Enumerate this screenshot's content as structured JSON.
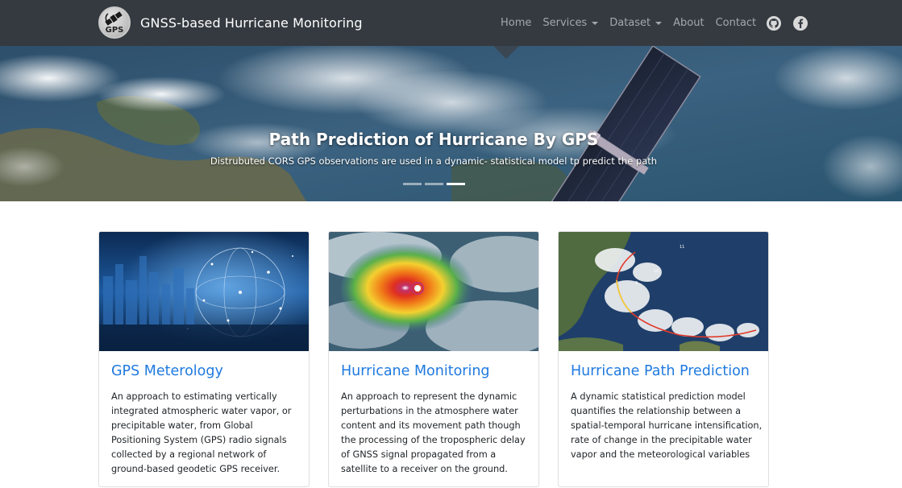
{
  "navbar": {
    "brand_title": "GNSS-based Hurricane Monitoring",
    "logo_text": "GPS",
    "links": {
      "home": "Home",
      "services": "Services",
      "dataset": "Dataset",
      "about": "About",
      "contact": "Contact"
    },
    "icons": [
      "github-icon",
      "facebook-icon"
    ],
    "background": "#343a40"
  },
  "hero": {
    "title": "Path Prediction of Hurricane By GPS",
    "caption": "Distrubuted CORS GPS observations are used in a dynamic- statistical model tp predict the path",
    "slide_count": 3,
    "active_slide": 3
  },
  "cards": [
    {
      "title": "GPS Meterology",
      "text": "An approach to estimating vertically integrated atmospheric water vapor, or precipitable water, from Global Positioning System (GPS) radio signals collected by a regional network of ground-based geodetic GPS receiver."
    },
    {
      "title": "Hurricane Monitoring",
      "text": "An approach to represent the dynamic perturbations in the atmosphere water content and its movement path though the processing of the tropospheric delay of GNSS signal propagated from a satellite to a receiver on the ground."
    },
    {
      "title": "Hurricane Path Prediction",
      "text": "A dynamic statistical prediction model quantifies the relationship between a spatial-temporal hurricane intensification, rate of change in the precipitable water vapor and the meteorological variables"
    }
  ],
  "colors": {
    "link": "#1f7ae0",
    "text": "#212529",
    "nav_text": "rgba(255,255,255,0.55)"
  }
}
